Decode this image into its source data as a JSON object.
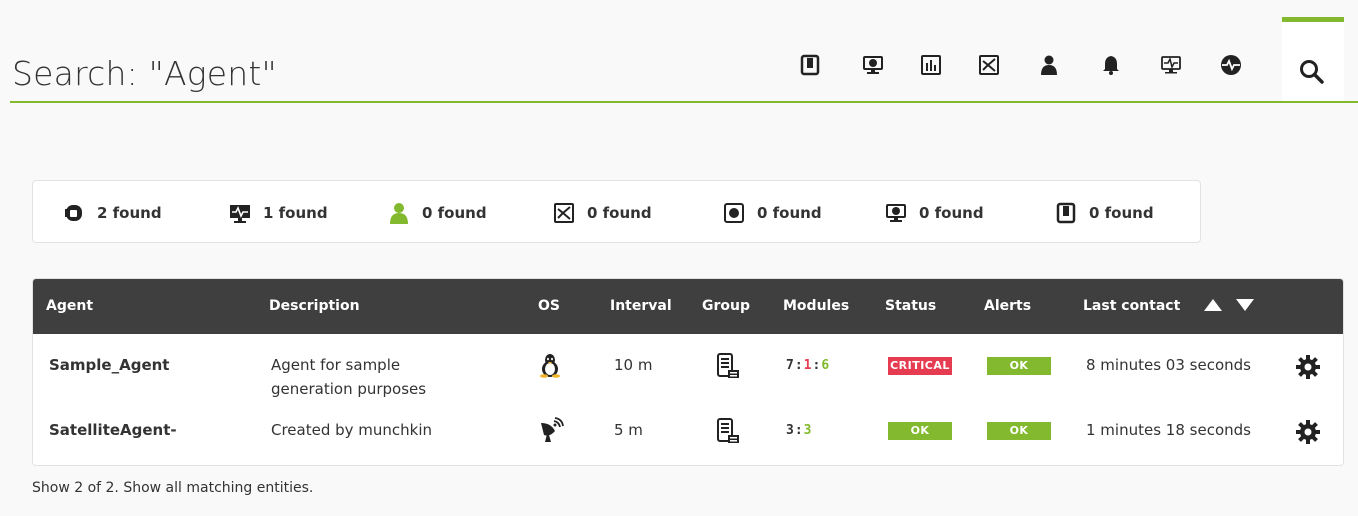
{
  "header": {
    "title": "Search: \"Agent\"",
    "icons": [
      "reports-icon",
      "visual-console-icon",
      "graphs-icon",
      "maps-icon",
      "users-icon",
      "alerts-icon",
      "modules-icon",
      "agent-status-icon",
      "search-icon"
    ]
  },
  "summary": [
    {
      "icon": "agents-icon",
      "text": "2 found"
    },
    {
      "icon": "modules-icon",
      "text": "1 found"
    },
    {
      "icon": "users-icon",
      "text": "0 found"
    },
    {
      "icon": "maps-icon",
      "text": "0 found"
    },
    {
      "icon": "reports-globe-icon",
      "text": "0 found"
    },
    {
      "icon": "visual-console-icon",
      "text": "0 found"
    },
    {
      "icon": "reports-icon",
      "text": "0 found"
    }
  ],
  "table": {
    "columns": {
      "agent": "Agent",
      "description": "Description",
      "os": "OS",
      "interval": "Interval",
      "group": "Group",
      "modules": "Modules",
      "status": "Status",
      "alerts": "Alerts",
      "last_contact": "Last contact"
    },
    "rows": [
      {
        "agent": "Sample_Agent",
        "description": "Agent for sample generation purposes",
        "os": "linux-icon",
        "interval": "10 m",
        "group": "server-group-icon",
        "modules_total": "7",
        "modules_crit": "1",
        "modules_ok": "6",
        "status": "CRITICAL",
        "alerts": "OK",
        "last_contact": "8 minutes 03 seconds"
      },
      {
        "agent": "SatelliteAgent-",
        "description": "Created by munchkin",
        "os": "satellite-icon",
        "interval": "5 m",
        "group": "server-group-icon",
        "modules_total": "3",
        "modules_crit": "",
        "modules_ok": "3",
        "status": "OK",
        "alerts": "OK",
        "last_contact": "1 minutes 18 seconds"
      }
    ]
  },
  "footer": {
    "text": "Show 2 of 2. Show all matching entities."
  },
  "colors": {
    "accent": "#82b92e",
    "critical": "#e63c52",
    "header_bg": "#3f3f3f"
  }
}
